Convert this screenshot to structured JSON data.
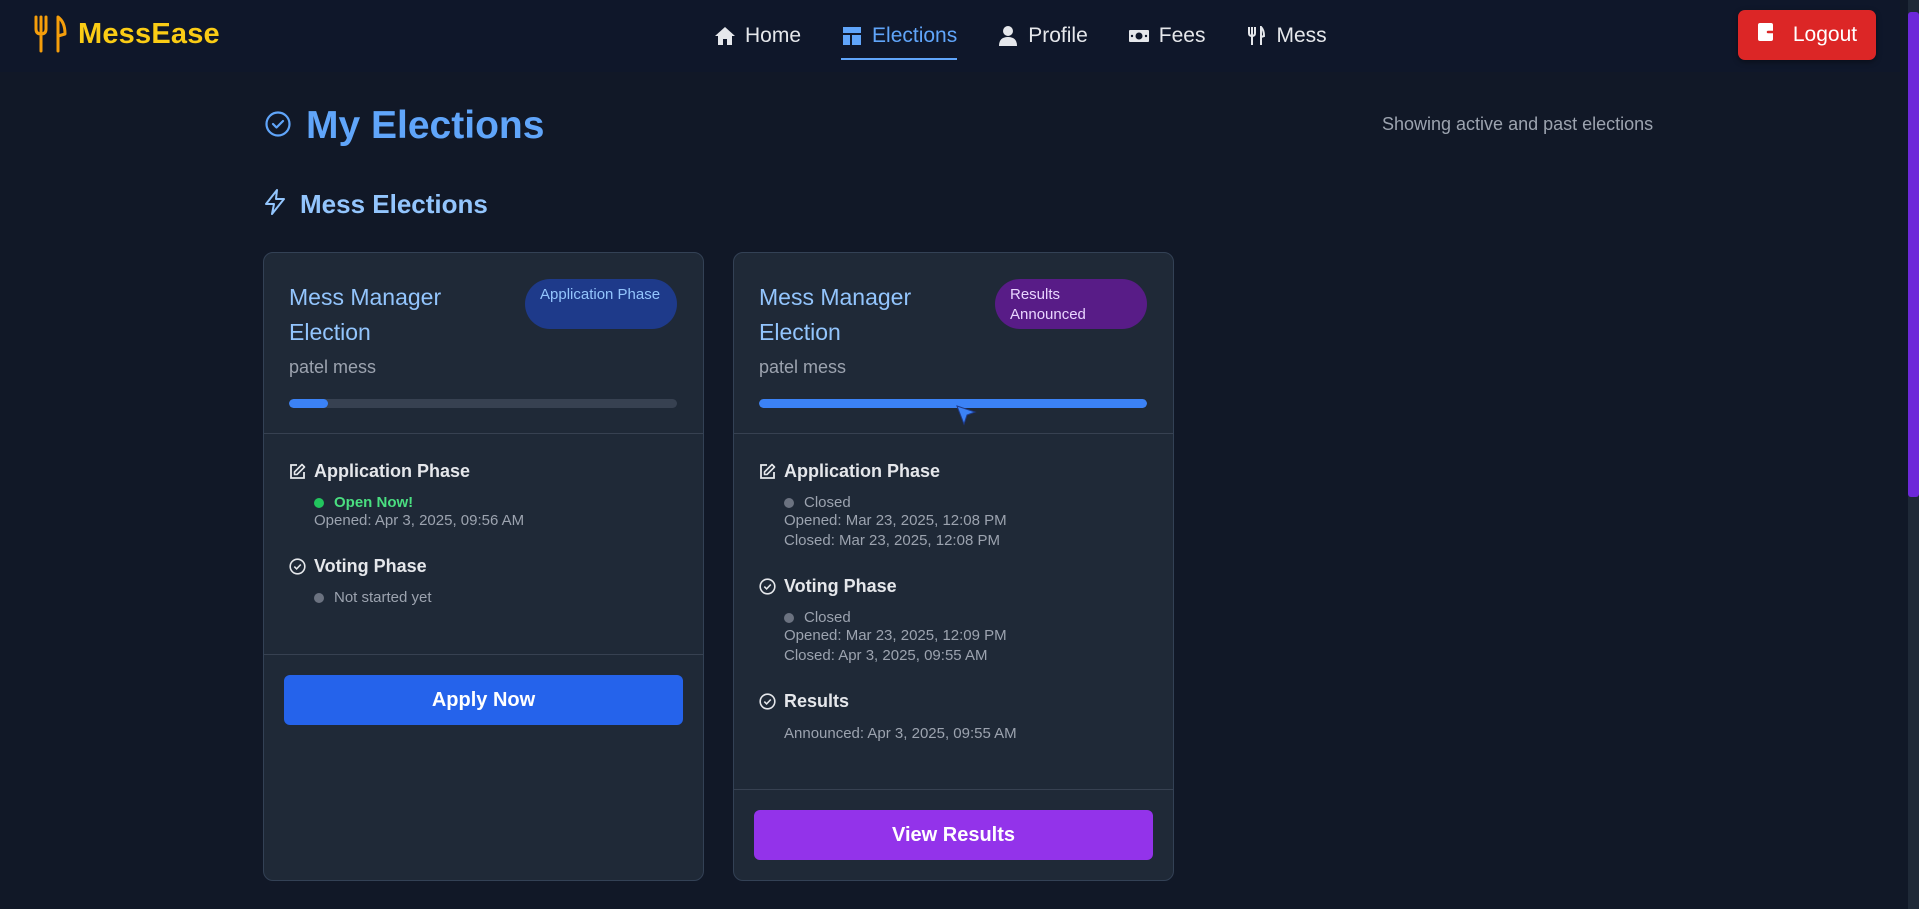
{
  "brand": {
    "name": "MessEase",
    "icon": "utensils-icon",
    "color": "#facc15"
  },
  "nav": {
    "items": [
      {
        "label": "Home",
        "icon": "home-icon",
        "active": false
      },
      {
        "label": "Elections",
        "icon": "ballot-icon",
        "active": true
      },
      {
        "label": "Profile",
        "icon": "user-icon",
        "active": false
      },
      {
        "label": "Fees",
        "icon": "money-icon",
        "active": false
      },
      {
        "label": "Mess",
        "icon": "utensils-icon",
        "active": false
      }
    ],
    "logout_label": "Logout"
  },
  "page": {
    "title": "My Elections",
    "subtitle": "Showing active and past elections",
    "section_title": "Mess Elections"
  },
  "cards": [
    {
      "title": "Mess Manager Election",
      "badge": "Application Phase",
      "mess": "patel mess",
      "progress": 0.1,
      "phases": [
        {
          "name": "Application Phase",
          "status": "Open Now!",
          "lines": [
            "Opened: Apr 3, 2025, 09:56 AM"
          ]
        },
        {
          "name": "Voting Phase",
          "status": "Not started yet",
          "lines": []
        }
      ],
      "button": "Apply Now"
    },
    {
      "title": "Mess Manager Election",
      "badge": "Results Announced",
      "mess": "patel mess",
      "progress": 1.0,
      "phases": [
        {
          "name": "Application Phase",
          "status": "Closed",
          "lines": [
            "Opened: Mar 23, 2025, 12:08 PM",
            "Closed: Mar 23, 2025, 12:08 PM"
          ]
        },
        {
          "name": "Voting Phase",
          "status": "Closed",
          "lines": [
            "Opened: Mar 23, 2025, 12:09 PM",
            "Closed: Apr 3, 2025, 09:55 AM"
          ]
        },
        {
          "name": "Results",
          "status": "",
          "lines": [
            "Announced: Apr 3, 2025, 09:55 AM"
          ]
        }
      ],
      "button": "View Results"
    }
  ],
  "colors": {
    "accent": "#60a5fa",
    "logout": "#dc2626",
    "apply": "#2563eb",
    "view": "#9333ea",
    "open": "#4ade80"
  }
}
